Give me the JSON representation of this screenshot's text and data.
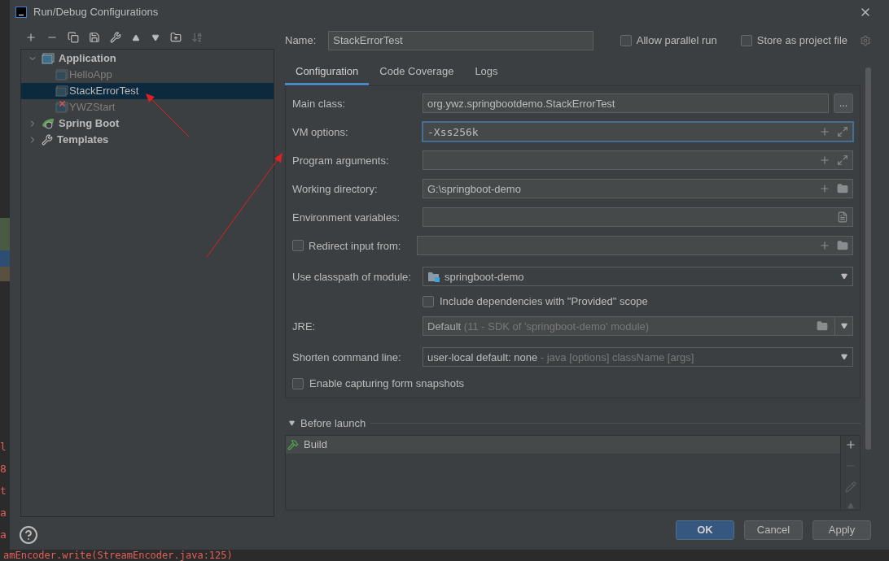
{
  "window": {
    "title": "Run/Debug Configurations"
  },
  "background": {
    "gutter_chars": [
      "l",
      "8",
      "t",
      "a",
      "a"
    ],
    "console_line": "amEncoder.write(StreamEncoder.java:125)"
  },
  "tree": [
    {
      "label": "Application",
      "kind": "group",
      "expanded": true,
      "children": [
        {
          "label": "HelloApp",
          "selected": false,
          "error": false
        },
        {
          "label": "StackErrorTest",
          "selected": true,
          "error": false
        },
        {
          "label": "YWZStart",
          "selected": false,
          "error": true
        }
      ]
    },
    {
      "label": "Spring Boot",
      "kind": "spring",
      "expanded": false
    },
    {
      "label": "Templates",
      "kind": "templates",
      "expanded": false
    }
  ],
  "name": {
    "label": "Name:",
    "value": "StackErrorTest"
  },
  "options": [
    {
      "label": "Allow parallel run",
      "checked": false
    },
    {
      "label": "Store as project file",
      "checked": false
    }
  ],
  "tabs": [
    {
      "label": "Configuration",
      "selected": true
    },
    {
      "label": "Code Coverage",
      "selected": false
    },
    {
      "label": "Logs",
      "selected": false
    }
  ],
  "form": [
    {
      "kind": "text",
      "label": "Main class:",
      "value": "org.ywz.springbootdemo.StackErrorTest",
      "focused": false,
      "button": "..."
    },
    {
      "kind": "text",
      "label": "VM options:",
      "value": "-Xss256k",
      "focused": true,
      "actions": [
        {
          "kind": "add"
        },
        {
          "kind": "expand"
        }
      ]
    },
    {
      "kind": "text",
      "label": "Program arguments:",
      "focused": false,
      "actions": [
        {
          "kind": "add"
        },
        {
          "kind": "expand"
        }
      ]
    },
    {
      "kind": "text",
      "label": "Working directory:",
      "value": "G:\\springboot-demo",
      "focused": false,
      "actions": [
        {
          "kind": "add"
        },
        {
          "kind": "folder"
        }
      ]
    },
    {
      "kind": "text",
      "label": "Environment variables:",
      "focused": false,
      "actions": [
        {
          "kind": "list"
        }
      ]
    },
    {
      "kind": "checkfield",
      "label": "Redirect input from:",
      "checked": false,
      "focused": false,
      "actions": [
        {
          "kind": "add"
        },
        {
          "kind": "folder"
        }
      ]
    },
    {
      "kind": "combo",
      "label": "Use classpath of module:",
      "value": "springboot-demo",
      "module_icon": true
    },
    {
      "kind": "check",
      "label": "Include dependencies with \"Provided\" scope",
      "checked": false
    },
    {
      "kind": "jre",
      "label": "JRE:",
      "value": "Default",
      "hint": "(11 - SDK of 'springboot-demo' module)"
    },
    {
      "kind": "combo",
      "label": "Shorten command line:",
      "value": "user-local default: none",
      "module_icon": false,
      "hint": "- java [options] className [args]"
    },
    {
      "kind": "checkrow",
      "label": "Enable capturing form snapshots",
      "checked": false
    }
  ],
  "before_launch": {
    "title": "Before launch",
    "expanded": true,
    "tasks": [
      "Build"
    ]
  },
  "buttons": [
    {
      "label": "OK",
      "kind": "primary"
    },
    {
      "label": "Cancel",
      "kind": "normal"
    },
    {
      "label": "Apply",
      "kind": "normal"
    }
  ]
}
